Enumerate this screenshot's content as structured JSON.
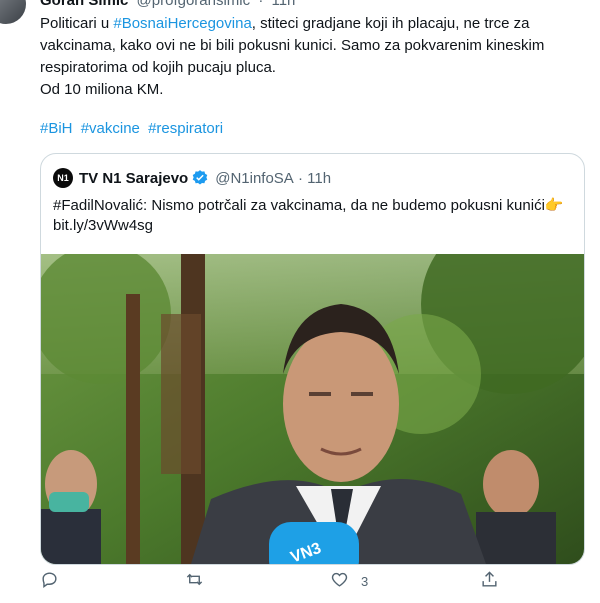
{
  "author": {
    "name": "Goran Simic",
    "handle": "@profgoransimic",
    "time": "11h"
  },
  "tweet": {
    "mention_prefix": "Politicari u ",
    "mention_tag": "#BosnaiHercegovina",
    "line1_rest": ", stiteci  gradjane koji ih placaju, ne trce za vakcinama, kako ovi ne bi bili pokusni kunici. Samo za pokvarenim kineskim respiratorima od kojih pucaju pluca.",
    "line2": "Od 10 miliona KM."
  },
  "hashtags": [
    "#BiH",
    "#vakcine",
    "#respiratori"
  ],
  "quoted": {
    "avatar_text": "N1",
    "name": "TV N1 Sarajevo",
    "handle": "@N1infoSA",
    "time": "11h",
    "text": "#FadilNovalić: Nismo potrčali za vakcinama, da ne budemo pokusni kunići👉bit.ly/3vWw4sg",
    "mic_label": "VN3"
  },
  "actions": {
    "reply_icon": "reply-icon",
    "retweet_icon": "retweet-icon",
    "like_icon": "heart-icon",
    "like_count": "3",
    "share_icon": "share-icon"
  },
  "colors": {
    "link": "#1b95e0",
    "muted": "#536471",
    "verified": "#1d9bf0",
    "border": "#cfd9de"
  }
}
